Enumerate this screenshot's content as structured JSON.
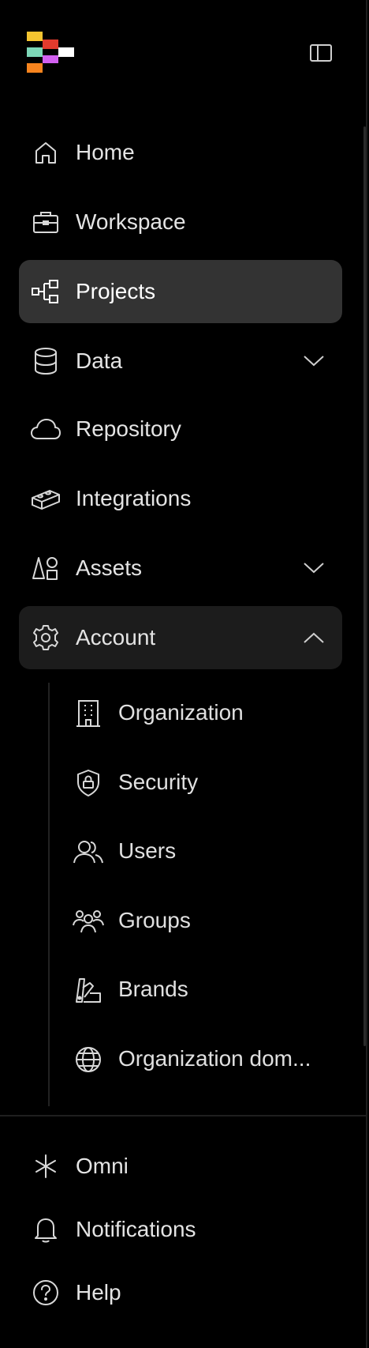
{
  "app": {
    "logo_colors": [
      "#f4c430",
      "#e13b2d",
      "#7dd7b7",
      "#d260f0",
      "#ffffff",
      "#f7841e"
    ]
  },
  "nav": {
    "home": "Home",
    "workspace": "Workspace",
    "projects": "Projects",
    "data": "Data",
    "repository": "Repository",
    "integrations": "Integrations",
    "assets": "Assets",
    "account": "Account"
  },
  "account_sub": {
    "organization": "Organization",
    "security": "Security",
    "users": "Users",
    "groups": "Groups",
    "brands": "Brands",
    "org_domains": "Organization dom..."
  },
  "footer": {
    "omni": "Omni",
    "notifications": "Notifications",
    "help": "Help"
  },
  "icons": {
    "home": "home-icon",
    "workspace": "briefcase-icon",
    "projects": "project-tree-icon",
    "data": "database-icon",
    "repository": "cloud-icon",
    "integrations": "brick-icon",
    "assets": "shapes-icon",
    "account": "gear-icon",
    "organization": "building-icon",
    "security": "shield-lock-icon",
    "users": "users-icon",
    "groups": "group-icon",
    "brands": "swatch-icon",
    "org_domains": "globe-icon",
    "omni": "asterisk-icon",
    "notifications": "bell-icon",
    "help": "help-icon"
  },
  "colors": {
    "background": "#000000",
    "active_bg": "#333333",
    "expanded_bg": "#1c1c1c",
    "text": "#e4e4e4"
  },
  "state": {
    "active_item": "Projects",
    "expanded_item": "Account"
  }
}
